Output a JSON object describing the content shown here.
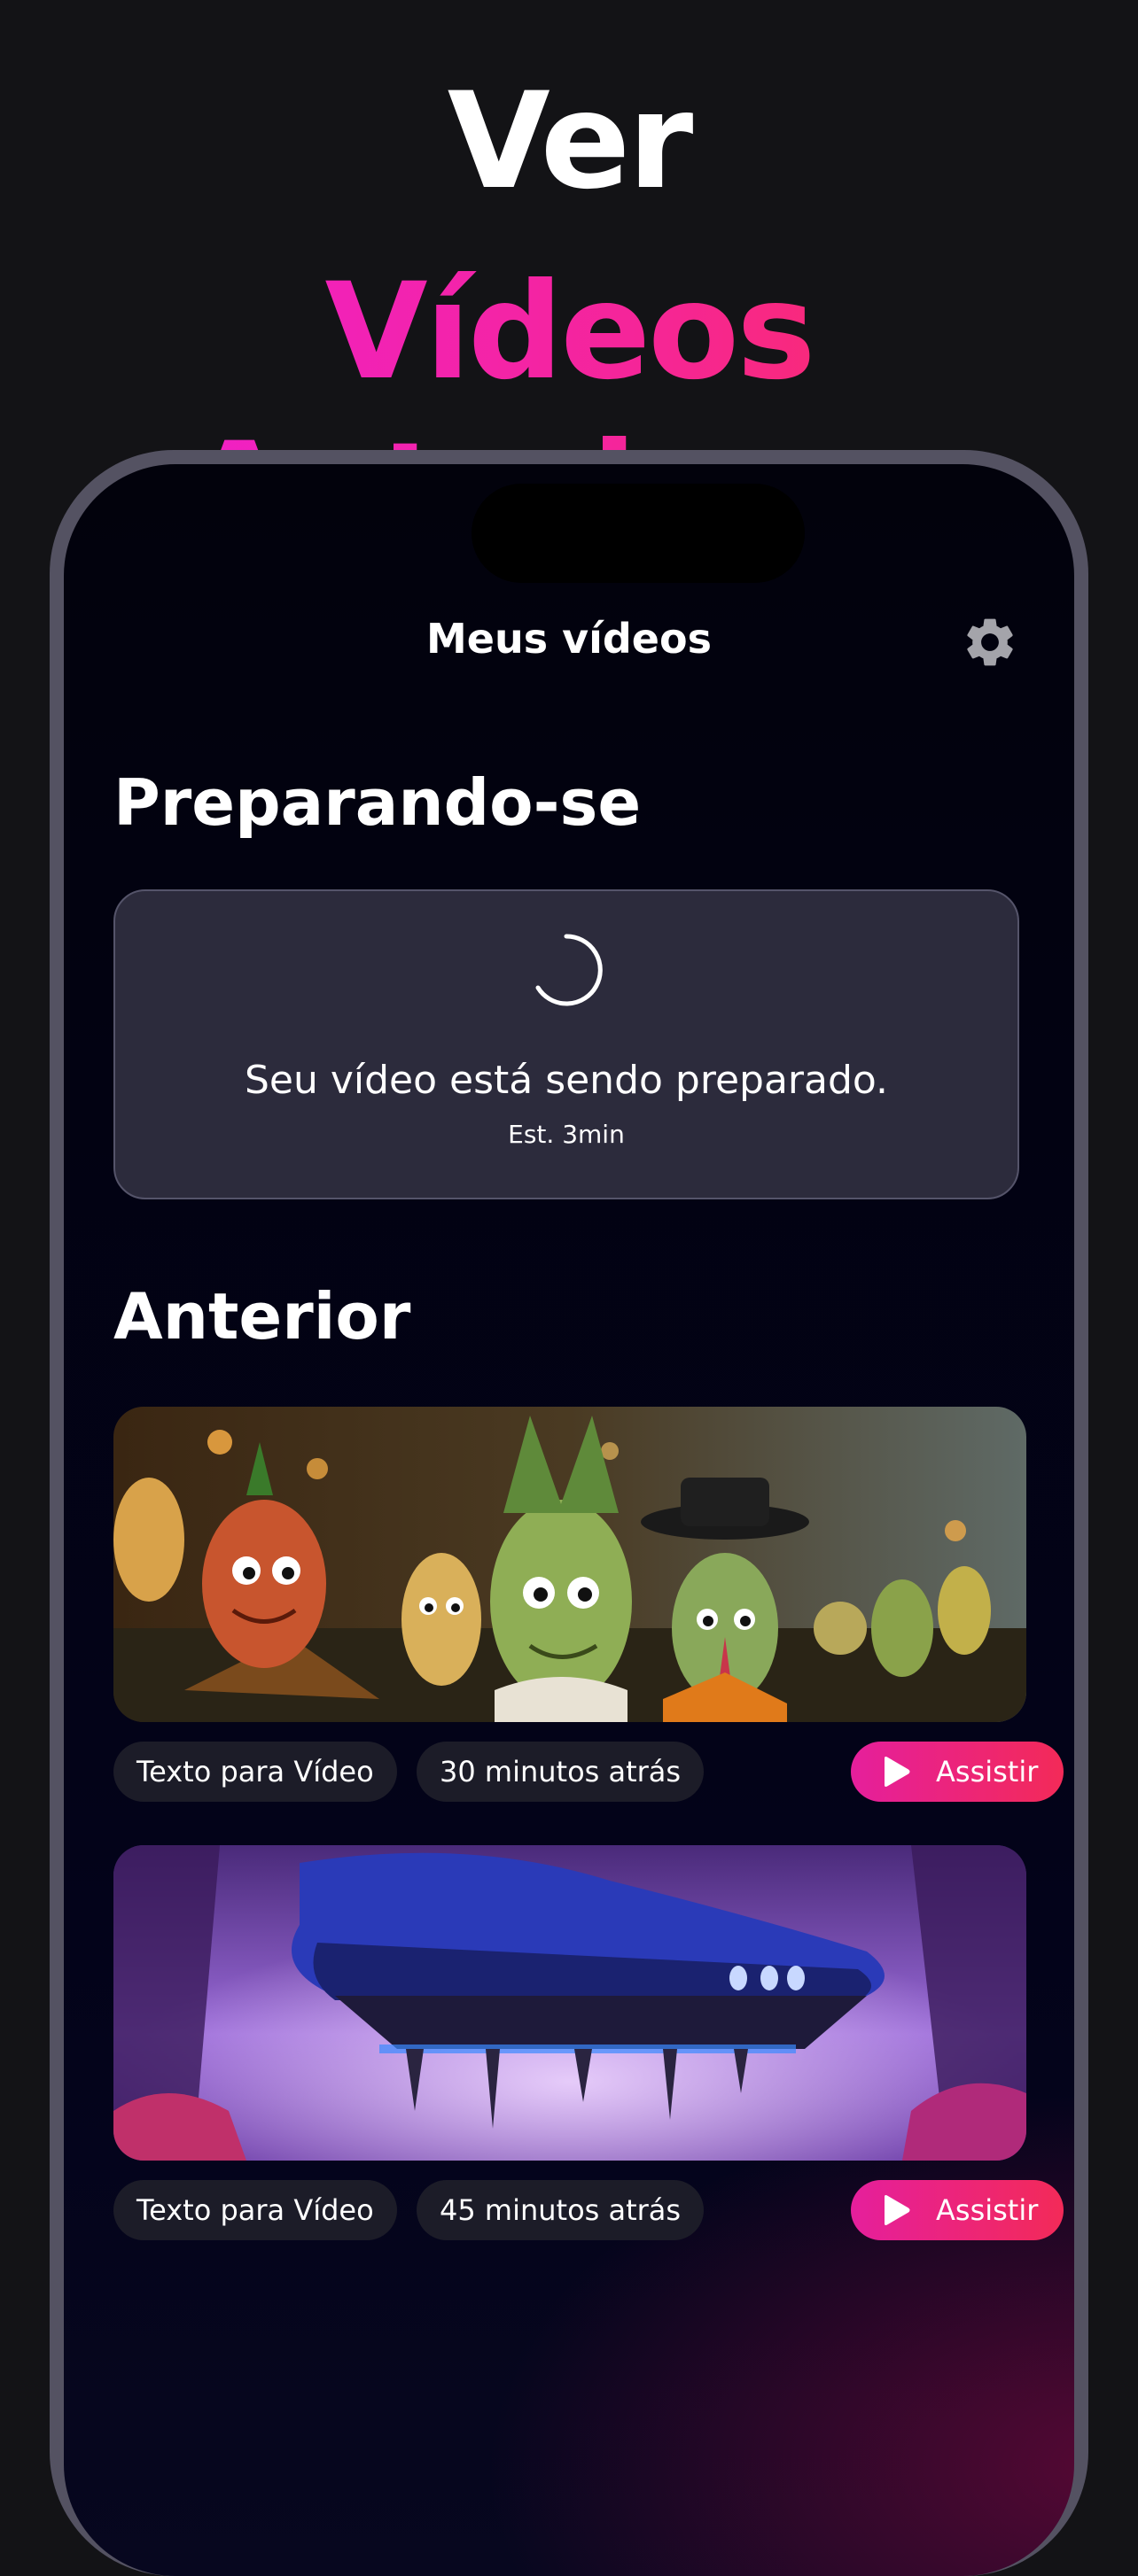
{
  "promo": {
    "title_line1": "Ver",
    "title_line2": "Vídeos Anteriores"
  },
  "nav": {
    "title": "Meus vídeos",
    "settings_icon": "gear-icon"
  },
  "preparing": {
    "heading": "Preparando-se",
    "message": "Seu vídeo está sendo preparado.",
    "estimate": "Est. 3min",
    "icon": "loading-spinner-icon"
  },
  "previous": {
    "heading": "Anterior",
    "videos": [
      {
        "type_tag": "Texto para Vídeo",
        "time_tag": "30 minutos atrás",
        "watch_label": "Assistir",
        "thumbnail": "vegetable-characters-crowd"
      },
      {
        "type_tag": "Texto para Vídeo",
        "time_tag": "45 minutos atrás",
        "watch_label": "Assistir",
        "thumbnail": "floating-sneaker-spaceship"
      }
    ]
  },
  "colors": {
    "accent_start": "#e51f9c",
    "accent_end": "#f32a58",
    "background": "#131316",
    "card": "#2c2b3c"
  }
}
